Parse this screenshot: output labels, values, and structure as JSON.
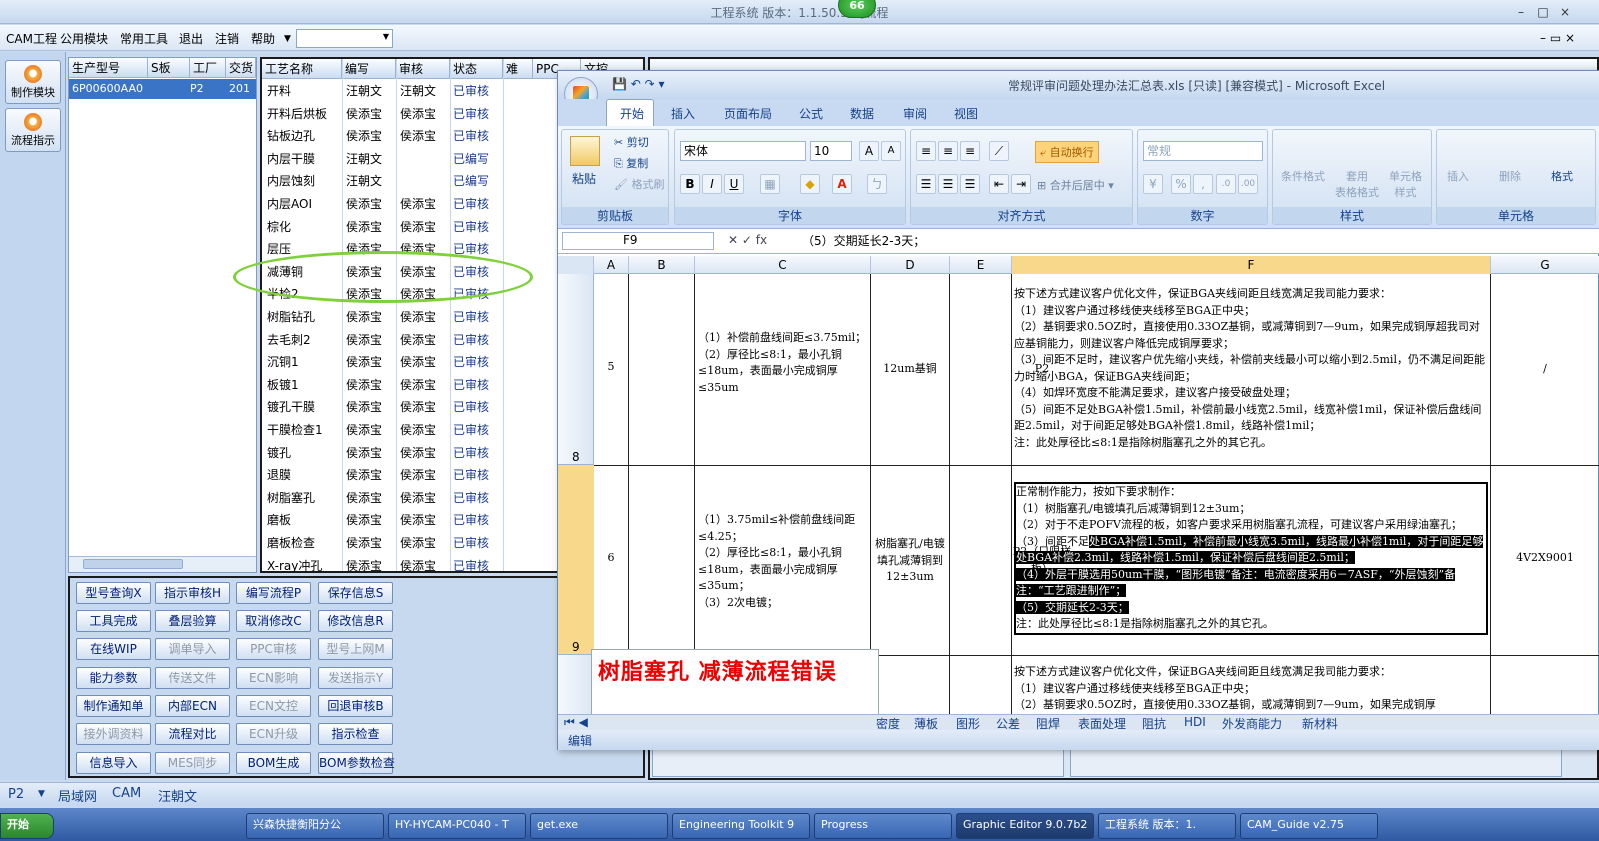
{
  "app": {
    "title": "工程系统  版本：1.1.50.5 - [流程",
    "badge": "66"
  },
  "menu": [
    "CAM工程",
    "公用模块",
    "常用工具",
    "退出",
    "注销",
    "帮助"
  ],
  "left_buttons": [
    "制作模块",
    "流程指示"
  ],
  "prod_table": {
    "headers": [
      "生产型号",
      "S板",
      "工厂",
      "交货"
    ],
    "row": [
      "6P00600AA0",
      "",
      "P2",
      "201"
    ]
  },
  "proc_table": {
    "headers": [
      "工艺名称",
      "编写",
      "审核",
      "状态",
      "难",
      "PPC",
      "文控"
    ],
    "rows": [
      [
        "开料",
        "汪朝文",
        "汪朝文",
        "已审核"
      ],
      [
        "开料后烘板",
        "侯添宝",
        "侯添宝",
        "已审核"
      ],
      [
        "钻板边孔",
        "侯添宝",
        "侯添宝",
        "已审核"
      ],
      [
        "内层干膜",
        "汪朝文",
        "",
        "已编写"
      ],
      [
        "内层蚀刻",
        "汪朝文",
        "",
        "已编写"
      ],
      [
        "内层AOI",
        "侯添宝",
        "侯添宝",
        "已审核"
      ],
      [
        "棕化",
        "侯添宝",
        "侯添宝",
        "已审核"
      ],
      [
        "层压",
        "侯添宝",
        "侯添宝",
        "已审核"
      ],
      [
        "减薄铜",
        "侯添宝",
        "侯添宝",
        "已审核"
      ],
      [
        "半检2",
        "侯添宝",
        "侯添宝",
        "已审核"
      ],
      [
        "树脂钻孔",
        "侯添宝",
        "侯添宝",
        "已审核"
      ],
      [
        "去毛刺2",
        "侯添宝",
        "侯添宝",
        "已审核"
      ],
      [
        "沉铜1",
        "侯添宝",
        "侯添宝",
        "已审核"
      ],
      [
        "板镀1",
        "侯添宝",
        "侯添宝",
        "已审核"
      ],
      [
        "镀孔干膜",
        "侯添宝",
        "侯添宝",
        "已审核"
      ],
      [
        "干膜检查1",
        "侯添宝",
        "侯添宝",
        "已审核"
      ],
      [
        "镀孔",
        "侯添宝",
        "侯添宝",
        "已审核"
      ],
      [
        "退膜",
        "侯添宝",
        "侯添宝",
        "已审核"
      ],
      [
        "树脂塞孔",
        "侯添宝",
        "侯添宝",
        "已审核"
      ],
      [
        "磨板",
        "侯添宝",
        "侯添宝",
        "已审核"
      ],
      [
        "磨板检查",
        "侯添宝",
        "侯添宝",
        "已审核"
      ],
      [
        "X-ray冲孔",
        "侯添宝",
        "侯添宝",
        "已审核"
      ]
    ]
  },
  "buttons": [
    [
      "型号查询X",
      "指示审核H",
      "编写流程P",
      "保存信息S"
    ],
    [
      "工具完成",
      "叠层验算",
      "取消修改C",
      "修改信息R"
    ],
    [
      "在线WIP",
      "调单导入",
      "PPC审核",
      "型号上网M"
    ],
    [
      "能力参数",
      "传送文件",
      "ECN影响",
      "发送指示Y"
    ],
    [
      "制作通知单",
      "内部ECN",
      "ECN文控",
      "回退审核B"
    ],
    [
      "接外调资料",
      "流程对比",
      "ECN升级",
      "指示检查"
    ],
    [
      "信息导入",
      "MES同步",
      "BOM生成",
      "BOM参数检查"
    ]
  ],
  "buttons_disabled": [
    [
      false,
      false,
      false,
      false
    ],
    [
      false,
      false,
      false,
      false
    ],
    [
      false,
      true,
      true,
      true
    ],
    [
      false,
      true,
      true,
      true
    ],
    [
      false,
      false,
      true,
      false
    ],
    [
      true,
      false,
      true,
      false
    ],
    [
      false,
      true,
      false,
      false
    ]
  ],
  "excel": {
    "title": "常规评审问题处理办法汇总表.xls  [只读]  [兼容模式] - Microsoft Excel",
    "tabs": [
      "开始",
      "插入",
      "页面布局",
      "公式",
      "数据",
      "审阅",
      "视图"
    ],
    "ribbon": {
      "paste": "粘贴",
      "cut": "剪切",
      "copy": "复制",
      "fmt": "格式刷",
      "clipboard": "剪贴板",
      "font_name": "宋体",
      "font_size": "10",
      "font": "字体",
      "wrap": "自动换行",
      "merge": "合并后居中",
      "align": "对齐方式",
      "numfmt": "常规",
      "number": "数字",
      "cond": "条件格式",
      "table": "套用\n表格格式",
      "cellstyle": "单元格\n样式",
      "styles": "样式",
      "insert": "插入",
      "delete": "删除",
      "format": "格式",
      "cells": "单元格"
    },
    "namebox": "F9",
    "formula": "（5）交期延长2-3天；",
    "cols": [
      "A",
      "B",
      "C",
      "D",
      "E",
      "F",
      "G"
    ],
    "rows": {
      "r8": "8",
      "r9": "9"
    },
    "row8": {
      "a": "5",
      "c": "（1）补偿前盘线间距≤3.75mil；\n（2）厚径比≤8:1，最小孔铜≤18um，表面最小完成铜厚≤35um",
      "d": "12um基铜",
      "e": "P2",
      "g": "/",
      "f": [
        "按下述方式建议客户优化文件，保证BGA夹线间距且线宽满足我司能力要求：",
        "（1）建议客户通过移线使夹线移至BGA正中央；",
        "（2）基铜要求0.5OZ时，直接使用0.33OZ基铜，或减薄铜到7—9um，如果完成铜厚超我司对应基铜能力，则建议客户降低完成铜厚要求；",
        "（3）间距不足时，建议客户优先缩小夹线，补偿前夹线最小可以缩小到2.5mil，仍不满足间距能力时缩小BGA，保证BGA夹线间距；",
        "（4）如焊环宽度不能满足要求，建议客户接受破盘处理；",
        "（5）间距不足处BGA补偿1.5mil，补偿前最小线宽2.5mil，线宽补偿1mil，保证补偿后盘线间距2.5mil，对于间距足够处BGA补偿1.8mil，线路补偿1mil；",
        "注：此处厚径比≤8:1是指除树脂塞孔之外的其它孔。"
      ]
    },
    "row9": {
      "a": "6",
      "c": "（1）3.75mil≤补偿前盘线间距≤4.25；\n（2）厚径比≤8:1，最小孔铜≤18um，表面最小完成铜厚≤35um；\n（3）2次电镀；",
      "d": "树脂塞孔/电镀填孔减薄铜到12±3um",
      "e": "P2（只限样板）",
      "g": "4V2X9001",
      "f1": "正常制作能力，按如下要求制作：\n（1）树脂塞孔/电镀填孔后减薄铜到12±3um；\n（2）对于不走POFV流程的板，如客户要求采用树脂塞孔流程，可建议客户采用绿油塞孔；\n（3）间距不足",
      "f1hi": "处BGA补偿1.5mil，补偿前最小线宽3.5mil，线路最小补偿1mil，对于间距足够处BGA补偿2.3mil，线路补偿1.5mil，保证补偿后盘线间距2.5mil；\n（4）外层干膜选用50um干膜，“图形电镀”备注：电流密度采用6－7ASF，“外层蚀刻”备注：“工艺跟进制作”；\n（5）交期延长2-3天；",
      "f1end": "\n注：此处厚径比≤8:1是指除树脂塞孔之外的其它孔。"
    },
    "row10": {
      "f": "按下述方式建议客户优化文件，保证BGA夹线间距且线宽满足我司能力要求：\n（1）建议客户通过移线使夹线移至BGA正中央；\n（2）基铜要求0.5OZ时，直接使用0.33OZ基铜，或减薄铜到7—9um，如果完成铜厚"
    },
    "note": "树脂塞孔  减薄流程错误",
    "sheets": [
      "密度",
      "薄板",
      "图形",
      "公差",
      "阻焊",
      "表面处理",
      "阻抗",
      "HDI",
      "外发商能力",
      "新材料"
    ],
    "status": "编辑"
  },
  "statusbar": [
    "P2",
    "局域网",
    "CAM",
    "汪朝文"
  ],
  "taskbar": [
    "开始",
    "兴森快捷衡阳分公",
    "HY-HYCAM-PC040 - T",
    "get.exe",
    "Engineering Toolkit 9",
    "Progress",
    "Graphic Editor 9.0.7b2",
    "工程系统  版本：1.",
    "CAM_Guide v2.75"
  ]
}
